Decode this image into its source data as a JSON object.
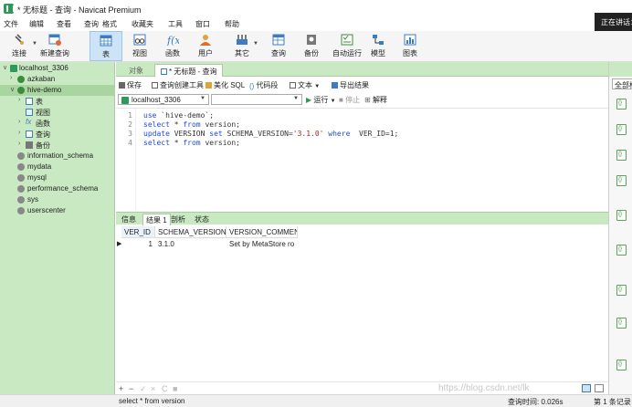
{
  "window": {
    "title": "* 无标题 - 查询 - Navicat Premium",
    "toast": "正在讲话："
  },
  "menu": [
    "文件",
    "编辑",
    "查看",
    "查询",
    "格式",
    "收藏夹",
    "工具",
    "窗口",
    "帮助"
  ],
  "toolbar": {
    "connect": "连接",
    "new_query": "新建查询",
    "table": "表",
    "view": "视图",
    "function": "函数",
    "user": "用户",
    "other": "其它",
    "query": "查询",
    "backup": "备份",
    "schedule": "自动运行",
    "model": "模型",
    "chart": "图表"
  },
  "tree": {
    "connection": "localhost_3306",
    "databases": [
      "azkaban",
      "hive-demo"
    ],
    "children": [
      "表",
      "视图",
      "函数",
      "查询",
      "备份"
    ],
    "others": [
      "information_schema",
      "mydata",
      "mysql",
      "performance_schema",
      "sys",
      "userscenter"
    ]
  },
  "tabs": {
    "objects": "对象",
    "query_tab": "* 无标题 - 查询"
  },
  "query_toolbar": {
    "save": "保存",
    "builder": "查询创建工具",
    "beautify": "美化 SQL",
    "snippet": "代码段",
    "text": "文本",
    "export": "导出结果"
  },
  "connbar": {
    "connection": "localhost_3306",
    "run": "运行",
    "stop": "停止",
    "explain": "解释"
  },
  "editor": {
    "line_numbers": [
      "1",
      "2",
      "3",
      "4"
    ],
    "lines": [
      [
        {
          "t": "use ",
          "c": "kw"
        },
        {
          "t": "`hive-demo`",
          "c": "id"
        },
        {
          "t": ";",
          "c": "id"
        }
      ],
      [
        {
          "t": "select ",
          "c": "kw"
        },
        {
          "t": "* ",
          "c": "id"
        },
        {
          "t": "from ",
          "c": "kw"
        },
        {
          "t": "version;",
          "c": "id"
        }
      ],
      [
        {
          "t": "update ",
          "c": "kw"
        },
        {
          "t": "VERSION ",
          "c": "id"
        },
        {
          "t": "set ",
          "c": "kw"
        },
        {
          "t": "SCHEMA_VERSION=",
          "c": "id"
        },
        {
          "t": "'3.1.0'",
          "c": "str"
        },
        {
          "t": " where ",
          "c": "kw"
        },
        {
          "t": " VER_ID=1;",
          "c": "id"
        }
      ],
      [
        {
          "t": "select ",
          "c": "kw"
        },
        {
          "t": "* ",
          "c": "id"
        },
        {
          "t": "from ",
          "c": "kw"
        },
        {
          "t": "version;",
          "c": "id"
        }
      ]
    ]
  },
  "result_tabs": [
    "信息",
    "结果 1",
    "剖析",
    "状态"
  ],
  "grid": {
    "columns": [
      "VER_ID",
      "SCHEMA_VERSION",
      "VERSION_COMMENT"
    ],
    "rows": [
      [
        "1",
        "3.1.0",
        "Set by MetaStore ro"
      ]
    ]
  },
  "grid_footer": [
    "+",
    "−",
    "✓",
    "×",
    "C",
    "■"
  ],
  "status": {
    "sql": "select * from version",
    "time": "查询时间: 0.026s",
    "records": "第 1 条记录"
  },
  "right_panel": {
    "button": "全部标"
  },
  "watermark": "https://blog.csdn.net/lk"
}
